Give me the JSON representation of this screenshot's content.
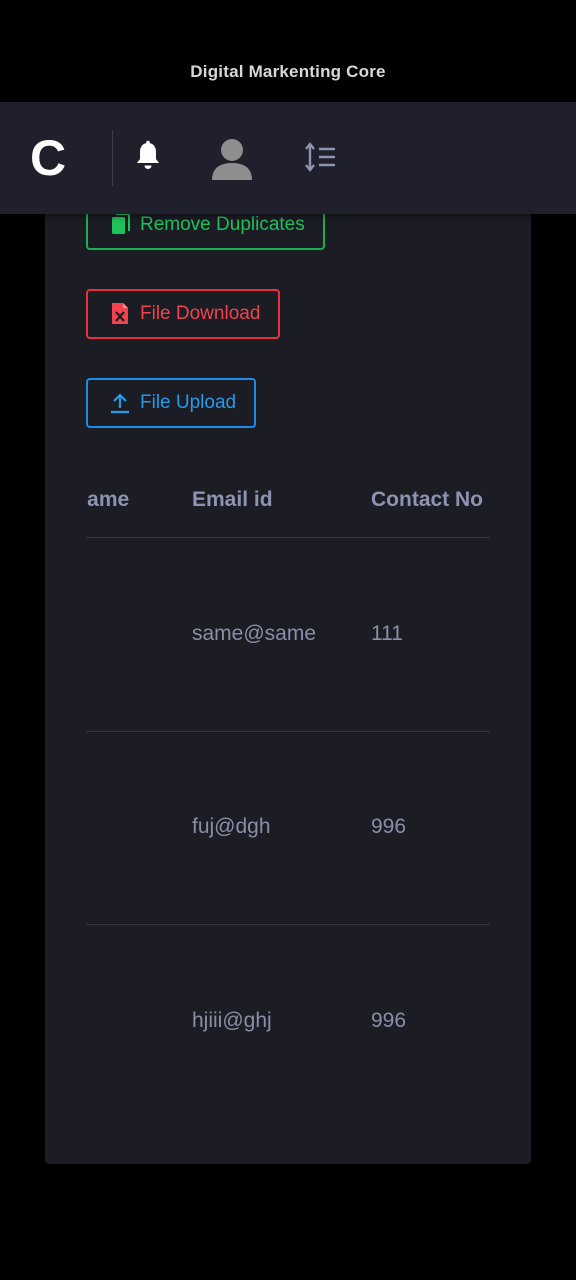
{
  "app": {
    "title": "Digital Markenting Core",
    "logo_letter": "C"
  },
  "topbar": {
    "icons": [
      "bell-icon",
      "user-avatar-icon",
      "sort-lines-icon"
    ]
  },
  "actions": {
    "remove_duplicates": "Remove Duplicates",
    "file_download": "File Download",
    "file_upload": "File Upload"
  },
  "table": {
    "columns": [
      "Name",
      "Email id",
      "Contact No"
    ],
    "rows": [
      {
        "name": "",
        "email": "same@same",
        "contact": "111"
      },
      {
        "name": "",
        "email": "fuj@dgh",
        "contact": "996"
      },
      {
        "name": "",
        "email": "hjiii@ghj",
        "contact": "996"
      }
    ]
  },
  "colors": {
    "green": "#1fc15b",
    "red": "#f0434e",
    "blue": "#249be8",
    "card_bg": "#1b1c24",
    "topbar_bg": "#1f202b"
  }
}
